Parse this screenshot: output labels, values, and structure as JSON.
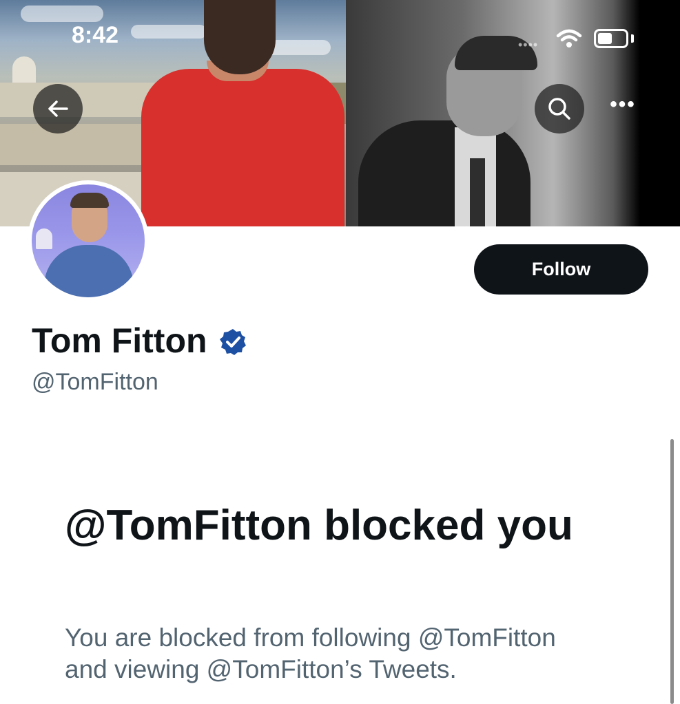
{
  "status_bar": {
    "time": "8:42",
    "signal_icon": "signal-dots-icon",
    "wifi_icon": "wifi-icon",
    "battery_icon": "battery-icon"
  },
  "header": {
    "back_icon": "back-arrow-icon",
    "search_icon": "search-icon",
    "more_icon": "more-icon"
  },
  "profile": {
    "display_name": "Tom Fitton",
    "handle": "@TomFitton",
    "verified_icon": "verified-badge-icon",
    "follow_label": "Follow"
  },
  "blocked": {
    "title": "@TomFitton blocked you",
    "description": "You are blocked from following @TomFitton and viewing @TomFitton’s Tweets."
  },
  "colors": {
    "primary_text": "#0f1419",
    "secondary_text": "#536471",
    "verified_blue": "#1d4fa3",
    "follow_button_bg": "#0f1419"
  }
}
